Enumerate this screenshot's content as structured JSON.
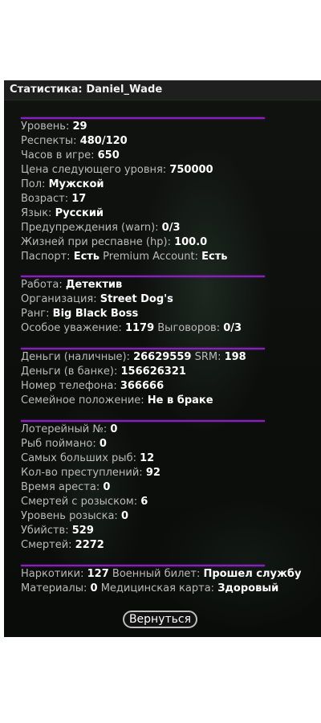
{
  "window": {
    "title": "Статистика: Daniel_Wade"
  },
  "sections": [
    {
      "rows": [
        [
          [
            "Уровень: ",
            "29"
          ]
        ],
        [
          [
            "Респекты: ",
            "480/120"
          ]
        ],
        [
          [
            "Часов в игре: ",
            "650"
          ]
        ],
        [
          [
            "Цена следующего уровня: ",
            "750000"
          ]
        ],
        [
          [
            "Пол: ",
            "Мужской"
          ]
        ],
        [
          [
            "Возраст: ",
            "17"
          ]
        ],
        [
          [
            "Язык: ",
            "Русский"
          ]
        ],
        [
          [
            "Предупреждения (warn): ",
            "0/3"
          ]
        ],
        [
          [
            "Жизней при респавне (hp): ",
            "100.0"
          ]
        ],
        [
          [
            "Паспорт: ",
            "Есть"
          ],
          [
            " Premium Account: ",
            "Есть"
          ]
        ]
      ]
    },
    {
      "rows": [
        [
          [
            "Работа: ",
            "Детектив"
          ]
        ],
        [
          [
            "Организация: ",
            "Street Dog's"
          ]
        ],
        [
          [
            "Ранг: ",
            "Big Black Boss"
          ]
        ],
        [
          [
            "Особое уважение: ",
            "1179"
          ],
          [
            " Выговоров: ",
            "0/3"
          ]
        ]
      ]
    },
    {
      "rows": [
        [
          [
            "Деньги (наличные): ",
            "26629559"
          ],
          [
            " SRM: ",
            "198"
          ]
        ],
        [
          [
            "Деньги (в банке): ",
            "156626321"
          ]
        ],
        [
          [
            "Номер телефона: ",
            "366666"
          ]
        ],
        [
          [
            "Семейное положение: ",
            "Не в браке"
          ]
        ]
      ]
    },
    {
      "rows": [
        [
          [
            "Лотерейный №: ",
            "0"
          ]
        ],
        [
          [
            "Рыб поймано: ",
            "0"
          ]
        ],
        [
          [
            "Самых больших рыб: ",
            "12"
          ]
        ],
        [
          [
            "Кол-во преступлений: ",
            "92"
          ]
        ],
        [
          [
            "Время ареста: ",
            "0"
          ]
        ],
        [
          [
            "Смертей с розыском: ",
            "6"
          ]
        ],
        [
          [
            "Уровень розыска: ",
            "0"
          ]
        ],
        [
          [
            "Убийств: ",
            "529"
          ]
        ],
        [
          [
            "Смертей: ",
            "2272"
          ]
        ]
      ]
    },
    {
      "rows": [
        [
          [
            "Наркотики: ",
            "127"
          ],
          [
            " Военный билет: ",
            "Прошел службу"
          ]
        ],
        [
          [
            "Материалы: ",
            "0"
          ],
          [
            " Медицинская карта: ",
            "Здоровый"
          ]
        ]
      ]
    }
  ],
  "buttons": {
    "back_label": "Вернуться"
  },
  "colors": {
    "separator": "#8a1fbf",
    "label": "#b9b9b9",
    "value": "#ffffff",
    "panel": "#0c0c0c",
    "titlebar": "#1f1f1f"
  }
}
